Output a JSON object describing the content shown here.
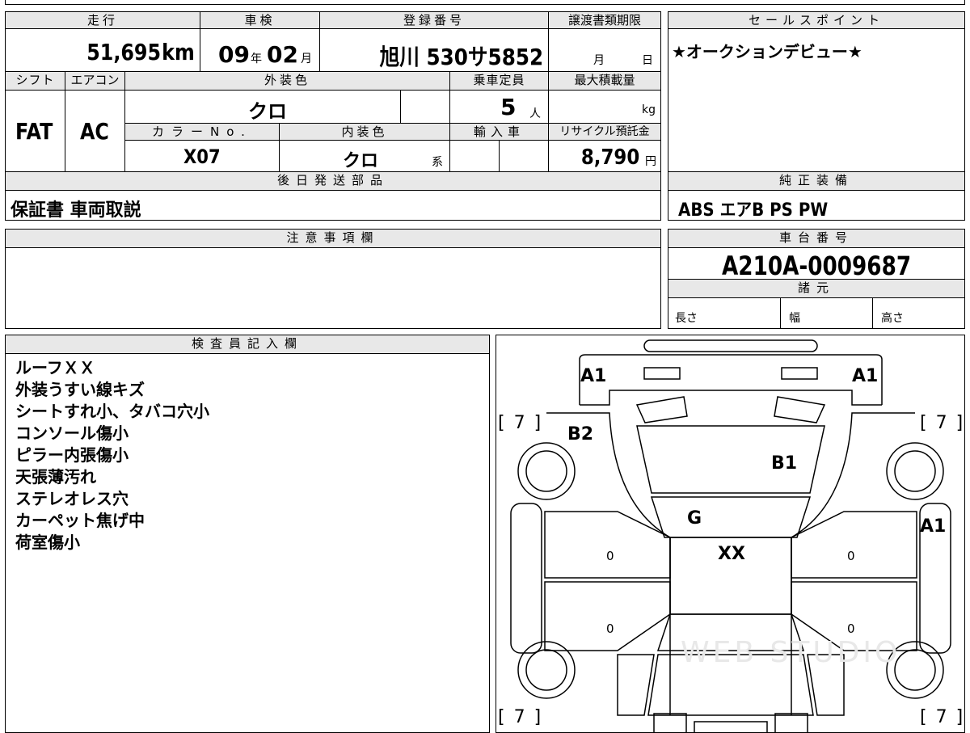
{
  "basic_info": {
    "mileage_label": "走行",
    "mileage_value": "51,695",
    "mileage_unit": "km",
    "inspection_label": "車検",
    "inspection_year": "09",
    "inspection_year_unit": "年",
    "inspection_month": "02",
    "inspection_month_unit": "月",
    "registration_label": "登録番号",
    "registration_value": "旭川 530サ5852",
    "transfer_deadline_label": "譲渡書類期限",
    "transfer_month_unit": "月",
    "transfer_day_unit": "日",
    "shift_label": "シフト",
    "shift_value": "FAT",
    "aircon_label": "エアコン",
    "aircon_value": "AC",
    "exterior_color_label": "外装色",
    "exterior_color_value": "クロ",
    "capacity_label": "乗車定員",
    "capacity_value": "5",
    "capacity_unit": "人",
    "max_load_label": "最大積載量",
    "max_load_unit": "kg",
    "color_no_label": "カラーNo.",
    "color_no_value": "X07",
    "interior_color_label": "内装色",
    "interior_color_value": "クロ",
    "interior_color_suffix": "系",
    "import_label": "輸入車",
    "recycle_label": "リサイクル預託金",
    "recycle_value": "8,790",
    "recycle_unit": "円"
  },
  "sales_point": {
    "label": "セールスポイント",
    "text": "★オークションデビュー★"
  },
  "later_shipment": {
    "label": "後日発送部品",
    "text": "保証書 車両取説"
  },
  "genuine_equipment": {
    "label": "純正装備",
    "text": "ABS エアB PS PW"
  },
  "notes": {
    "label": "注意事項欄"
  },
  "chassis": {
    "label": "車台番号",
    "value": "A210A-0009687"
  },
  "specs": {
    "label": "諸元",
    "length_label": "長さ",
    "width_label": "幅",
    "height_label": "高さ"
  },
  "inspector": {
    "label": "検査員記入欄",
    "remarks": [
      "ルーフＸＸ",
      "外装うすい線キズ",
      "シートすれ小、タバコ穴小",
      "コンソール傷小",
      "ピラー内張傷小",
      "天張薄汚れ",
      "ステレオレス穴",
      "カーペット焦げ中",
      "荷室傷小"
    ]
  },
  "diagram": {
    "marks": {
      "a1_left": "A1",
      "a1_right": "A1",
      "a1_side": "A1",
      "b2": "B2",
      "b1": "B1",
      "g": "G",
      "xx": "XX"
    },
    "tire_top_left": "[ 7 ]",
    "tire_top_right": "[ 7 ]",
    "tire_bottom_left": "[ 7 ]",
    "tire_bottom_right": "[ 7 ]",
    "door_fl": "0",
    "door_fr": "0",
    "door_rl": "0",
    "door_rr": "0",
    "watermark": "WEB STUDIO"
  }
}
